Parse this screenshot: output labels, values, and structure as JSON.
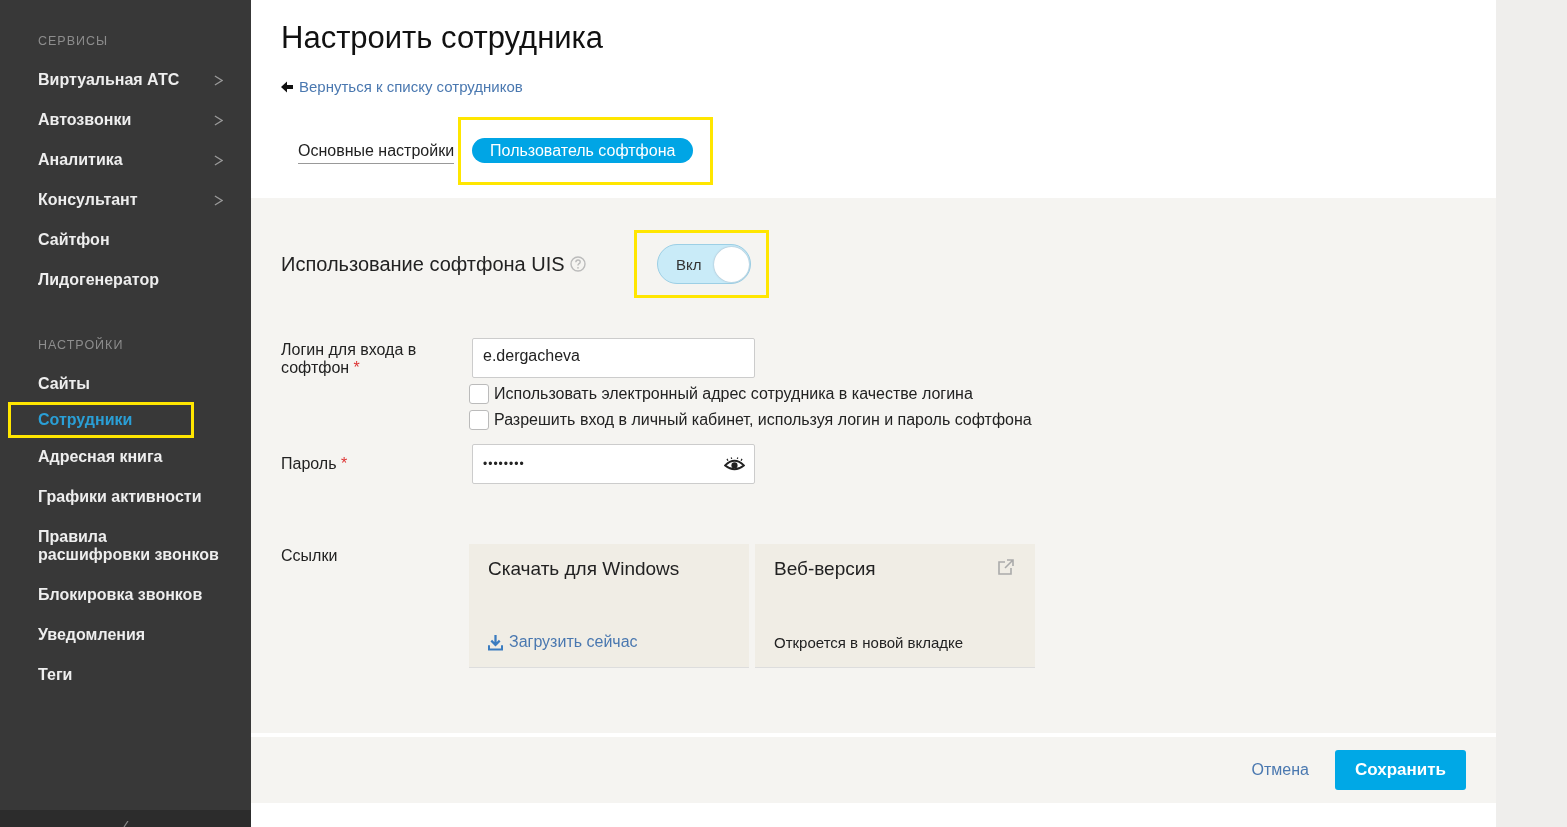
{
  "sidebar": {
    "sections": [
      {
        "title": "СЕРВИСЫ",
        "items": [
          {
            "label": "Виртуальная АТС",
            "has_submenu": true,
            "selected": false,
            "highlighted": false
          },
          {
            "label": "Автозвонки",
            "has_submenu": true,
            "selected": false,
            "highlighted": false
          },
          {
            "label": "Аналитика",
            "has_submenu": true,
            "selected": false,
            "highlighted": false
          },
          {
            "label": "Консультант",
            "has_submenu": true,
            "selected": false,
            "highlighted": false
          },
          {
            "label": "Сайтфон",
            "has_submenu": false,
            "selected": false,
            "highlighted": false
          },
          {
            "label": "Лидогенератор",
            "has_submenu": false,
            "selected": false,
            "highlighted": false
          }
        ]
      },
      {
        "title": "НАСТРОЙКИ",
        "items": [
          {
            "label": "Сайты",
            "has_submenu": false,
            "selected": false,
            "highlighted": false
          },
          {
            "label": "Сотрудники",
            "has_submenu": false,
            "selected": true,
            "highlighted": true
          },
          {
            "label": "Адресная книга",
            "has_submenu": false,
            "selected": false,
            "highlighted": false
          },
          {
            "label": "Графики активности",
            "has_submenu": false,
            "selected": false,
            "highlighted": false
          },
          {
            "label": "Правила расшифровки звонков",
            "has_submenu": false,
            "selected": false,
            "highlighted": false
          },
          {
            "label": "Блокировка звонков",
            "has_submenu": false,
            "selected": false,
            "highlighted": false
          },
          {
            "label": "Уведомления",
            "has_submenu": false,
            "selected": false,
            "highlighted": false
          },
          {
            "label": "Теги",
            "has_submenu": false,
            "selected": false,
            "highlighted": false
          }
        ]
      }
    ]
  },
  "page": {
    "title": "Настроить сотрудника",
    "back_link": "Вернуться к списку сотрудников"
  },
  "tabs": [
    {
      "label": "Основные настройки",
      "selected": false,
      "highlighted": false
    },
    {
      "label": "Пользователь софтфона",
      "selected": true,
      "highlighted": true
    }
  ],
  "softphone": {
    "label": "Использование софтфона UIS",
    "toggle": {
      "text": "Вкл",
      "on": true,
      "highlighted": true
    }
  },
  "login": {
    "label": "Логин для входа в софтфон",
    "required_mark": "*",
    "value": "e.dergacheva"
  },
  "checkboxes": [
    {
      "label": "Использовать электронный адрес сотрудника в качестве логина",
      "checked": false
    },
    {
      "label": "Разрешить вход в личный кабинет, используя логин и пароль софтфона",
      "checked": false
    }
  ],
  "password": {
    "label": "Пароль",
    "required_mark": "*",
    "value": "••••••••"
  },
  "links": {
    "label": "Ссылки",
    "cards": [
      {
        "kind": "download",
        "title": "Скачать для Windows",
        "action": "Загрузить сейчас"
      },
      {
        "kind": "external",
        "title": "Веб-версия",
        "note": "Откроется в новой вкладке"
      }
    ]
  },
  "footer": {
    "cancel": "Отмена",
    "save": "Сохранить"
  }
}
